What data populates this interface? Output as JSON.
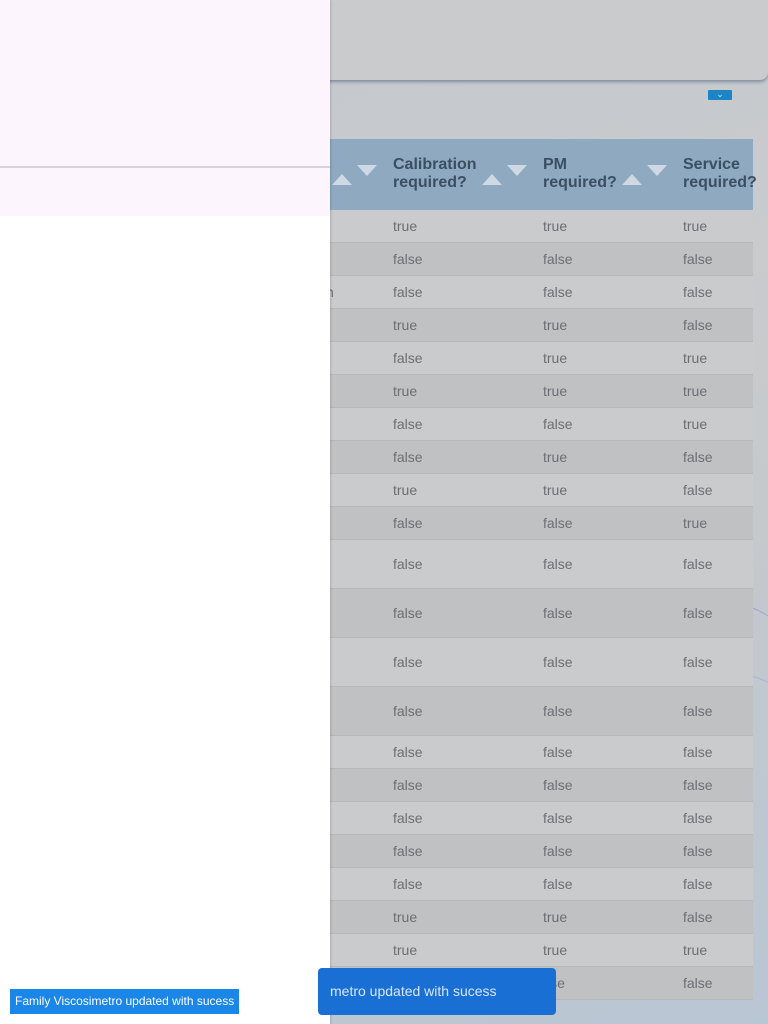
{
  "table": {
    "headers": [
      {
        "label_line1": "Calibration",
        "label_line2": "required?"
      },
      {
        "label_line1": "PM",
        "label_line2": "required?"
      },
      {
        "label_line1": "Service",
        "label_line2": "required?"
      }
    ],
    "rows": [
      {
        "cells": [
          "true",
          "true",
          "true"
        ]
      },
      {
        "cells": [
          "false",
          "false",
          "false"
        ]
      },
      {
        "cells": [
          "false",
          "false",
          "false"
        ],
        "left_fragment": "n"
      },
      {
        "cells": [
          "true",
          "true",
          "false"
        ]
      },
      {
        "cells": [
          "false",
          "true",
          "true"
        ]
      },
      {
        "cells": [
          "true",
          "true",
          "true"
        ]
      },
      {
        "cells": [
          "false",
          "false",
          "true"
        ]
      },
      {
        "cells": [
          "false",
          "true",
          "false"
        ]
      },
      {
        "cells": [
          "true",
          "true",
          "false"
        ]
      },
      {
        "cells": [
          "false",
          "false",
          "true"
        ]
      },
      {
        "cells": [
          "false",
          "false",
          "false"
        ]
      },
      {
        "cells": [
          "false",
          "false",
          "false"
        ]
      },
      {
        "cells": [
          "false",
          "false",
          "false"
        ]
      },
      {
        "cells": [
          "false",
          "false",
          "false"
        ]
      },
      {
        "cells": [
          "false",
          "false",
          "false"
        ]
      },
      {
        "cells": [
          "false",
          "false",
          "false"
        ]
      },
      {
        "cells": [
          "false",
          "false",
          "false"
        ]
      },
      {
        "cells": [
          "false",
          "false",
          "false"
        ]
      },
      {
        "cells": [
          "false",
          "false",
          "false"
        ]
      },
      {
        "cells": [
          "true",
          "true",
          "false"
        ]
      },
      {
        "cells": [
          "true",
          "true",
          "true"
        ]
      },
      {
        "cells": [
          "",
          "",
          "false"
        ]
      }
    ]
  },
  "snackbar": {
    "message": "metro updated with sucess",
    "hidden_cell_fragment": "lse"
  },
  "toast": {
    "message": "Family Viscosimetro updated with sucess"
  },
  "colors": {
    "header": "#8ea9c0",
    "snackbar": "#1a6fd4",
    "toast": "#1a86e8"
  },
  "icons": {
    "sort_ascending": "triangle-up-icon",
    "sort_descending": "triangle-down-icon",
    "dropdown": "chevron-down-icon"
  }
}
